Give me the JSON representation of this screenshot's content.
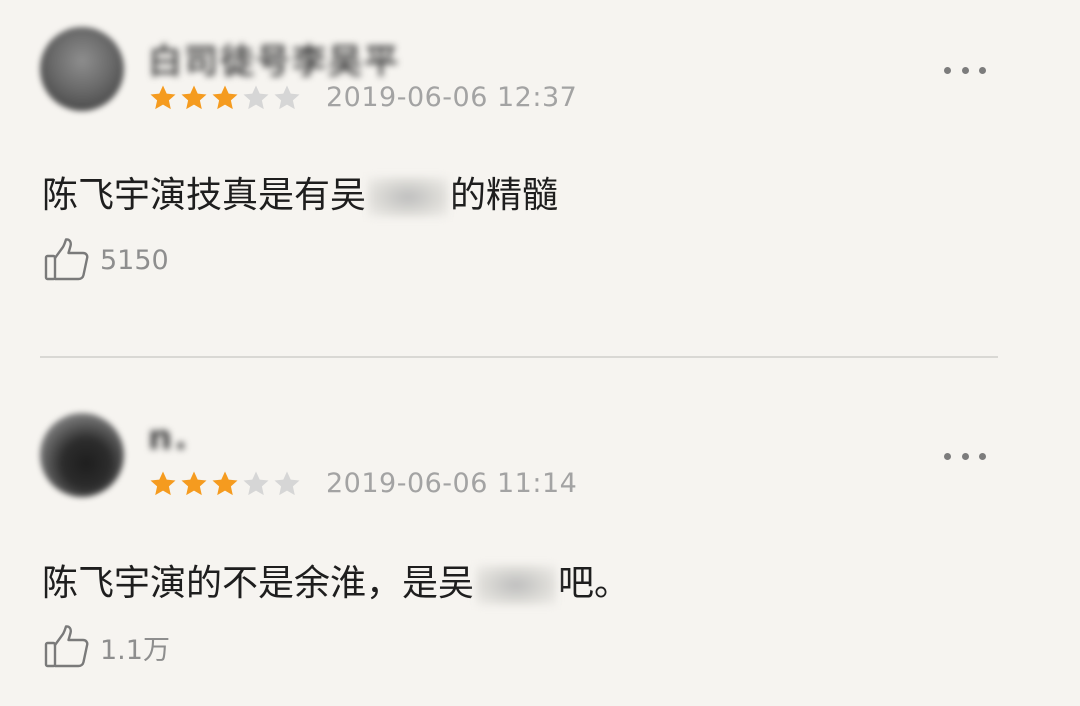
{
  "colors": {
    "background": "#f6f4f0",
    "star_filled": "#f59b1f",
    "star_empty": "#d6d6d6",
    "text_primary": "#1e1e1e",
    "text_secondary": "#a3a3a3",
    "divider": "#d9d8d4"
  },
  "comments": [
    {
      "username": "白司徒号李吴平",
      "rating": 3,
      "rating_max": 5,
      "timestamp": "2019-06-06 12:37",
      "text_before": "陈飞宇演技真是有吴",
      "text_after": "的精髓",
      "likes": "5150"
    },
    {
      "username": "n.",
      "rating": 3,
      "rating_max": 5,
      "timestamp": "2019-06-06 11:14",
      "text_before": "陈飞宇演的不是余淮，是吴",
      "text_after": "吧。",
      "likes": "1.1万"
    }
  ],
  "icons": {
    "more": "more-dots-icon",
    "like": "thumbs-up-icon",
    "star": "star-icon"
  }
}
